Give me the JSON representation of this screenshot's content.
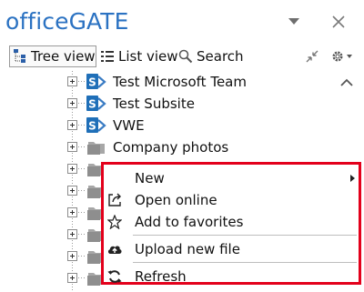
{
  "panel": {
    "title": "officeGATE",
    "menu_icon": "dropdown-triangle-icon",
    "close_icon": "close-icon"
  },
  "toolbar": {
    "tree_view_label": "Tree view",
    "list_view_label": "List view",
    "search_label": "Search",
    "tree_view_icon": "tree-icon",
    "list_view_icon": "list-icon",
    "search_icon": "search-icon",
    "collapse_icon": "collapse-icon",
    "settings_icon": "gear-icon"
  },
  "tree": {
    "items": [
      {
        "label": "Test Microsoft Team",
        "icon": "sharepoint-icon"
      },
      {
        "label": "Test Subsite",
        "icon": "sharepoint-icon"
      },
      {
        "label": "VWE",
        "icon": "sharepoint-icon"
      },
      {
        "label": "Company photos",
        "icon": "folder-icon"
      },
      {
        "label": "",
        "icon": "folder-icon"
      },
      {
        "label": "",
        "icon": "folder-icon"
      },
      {
        "label": "",
        "icon": "folder-icon"
      },
      {
        "label": "",
        "icon": "folder-icon"
      },
      {
        "label": "",
        "icon": "folder-icon"
      },
      {
        "label": "",
        "icon": "folder-icon"
      }
    ]
  },
  "context_menu": {
    "highlight_color": "#e3001b",
    "items": [
      {
        "label": "New",
        "icon": "",
        "has_submenu": true
      },
      {
        "label": "Open online",
        "icon": "open-external-icon"
      },
      {
        "label": "Add to favorites",
        "icon": "star-icon"
      },
      {
        "label": "Upload new file",
        "icon": "cloud-upload-icon"
      },
      {
        "label": "Refresh",
        "icon": "refresh-icon"
      }
    ]
  },
  "colors": {
    "title": "#2b72c2",
    "sharepoint": "#1f6fb8"
  }
}
